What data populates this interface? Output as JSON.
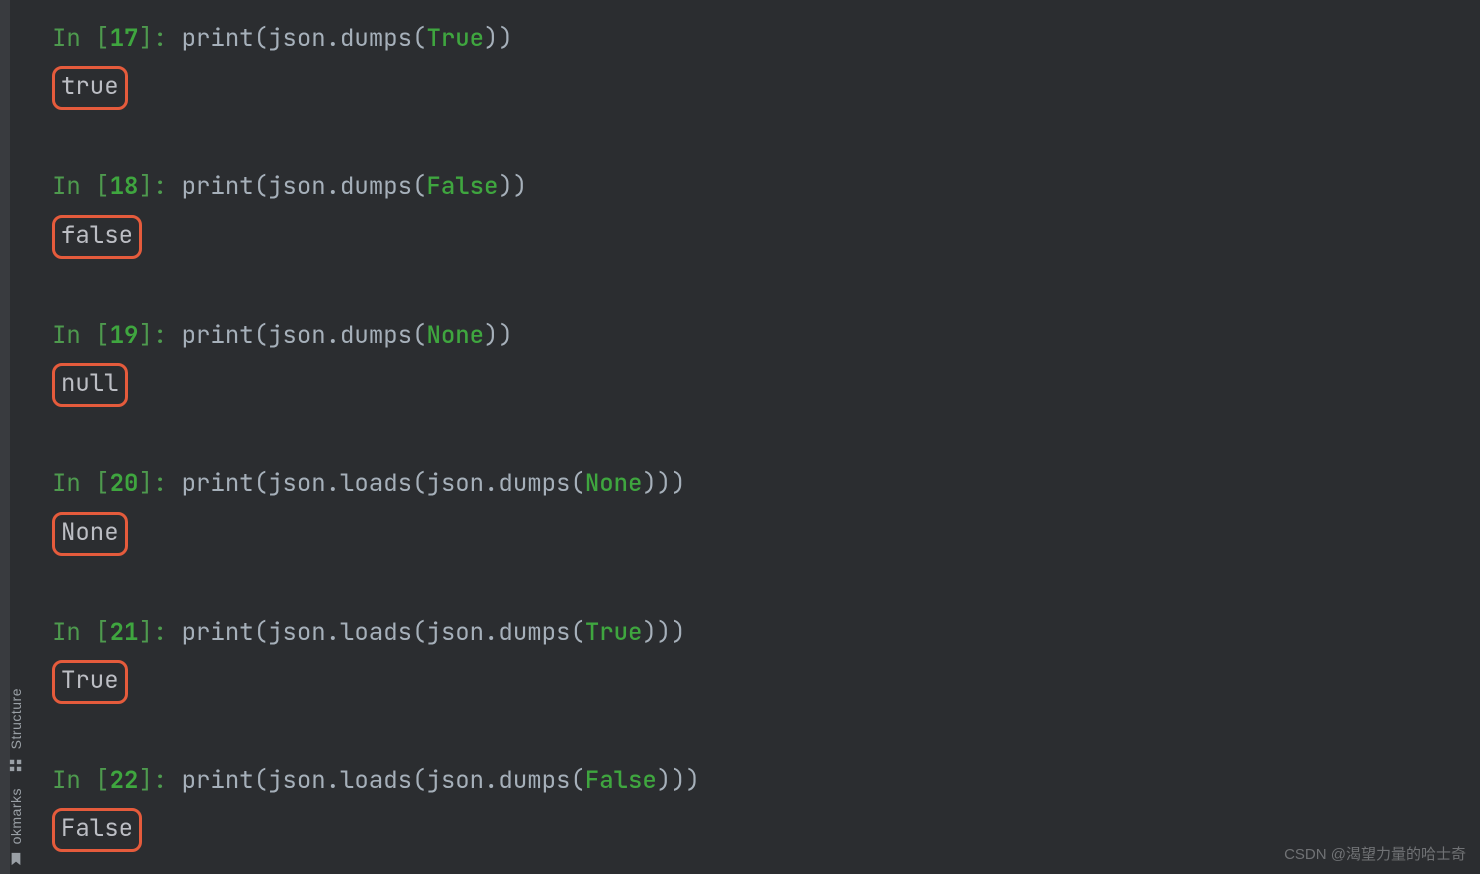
{
  "sidebar": {
    "structure": "Structure",
    "bookmarks": "okmarks"
  },
  "cells": [
    {
      "num": "17",
      "code_html": "<span class='fn'>print</span><span class='p'>(json.dumps(</span><span class='kw'>True</span><span class='p'>))</span>",
      "out": "true"
    },
    {
      "num": "18",
      "code_html": "<span class='fn'>print</span><span class='p'>(json.dumps(</span><span class='kw'>False</span><span class='p'>))</span>",
      "out": "false"
    },
    {
      "num": "19",
      "code_html": "<span class='fn'>print</span><span class='p'>(json.dumps(</span><span class='kw'>None</span><span class='p'>))</span>",
      "out": "null"
    },
    {
      "num": "20",
      "code_html": "<span class='fn'>print</span><span class='p'>(json.loads(json.dumps(</span><span class='kw'>None</span><span class='p'>)))</span>",
      "out": "None"
    },
    {
      "num": "21",
      "code_html": "<span class='fn'>print</span><span class='p'>(json.loads(json.dumps(</span><span class='kw'>True</span><span class='p'>)))</span>",
      "out": "True"
    },
    {
      "num": "22",
      "code_html": "<span class='fn'>print</span><span class='p'>(json.loads(json.dumps(</span><span class='kw'>False</span><span class='p'>)))</span>",
      "out": "False"
    }
  ],
  "prompt": {
    "in": "In ",
    "open": "[",
    "close": "]: "
  },
  "watermark": "CSDN @渴望力量的哈士奇"
}
